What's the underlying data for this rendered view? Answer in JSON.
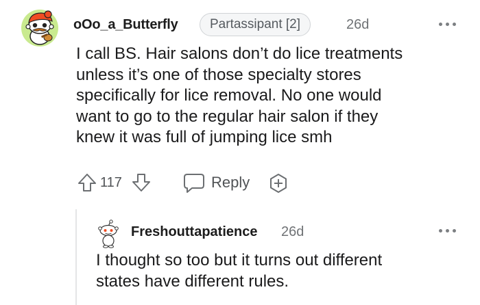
{
  "comment": {
    "username": "oOo_a_Butterfly",
    "flair": "Partassipant [2]",
    "timestamp": "26d",
    "avatar_icon": "snoo-avatar-orange-icon",
    "body_lines": [
      "I call BS. Hair salons don’t do lice treatments",
      "unless it’s one of those specialty stores",
      "specifically for lice removal. No one would",
      "want to go to the regular hair salon if they",
      "knew it was full of jumping lice smh"
    ],
    "score": "117",
    "reply_label": "Reply",
    "accent": "#f04c23"
  },
  "reply": {
    "username": "Freshouttapatience",
    "timestamp": "26d",
    "avatar_icon": "snoo-avatar-default-icon",
    "body_lines": [
      "I thought so too but it turns out different",
      "states have different rules."
    ]
  }
}
